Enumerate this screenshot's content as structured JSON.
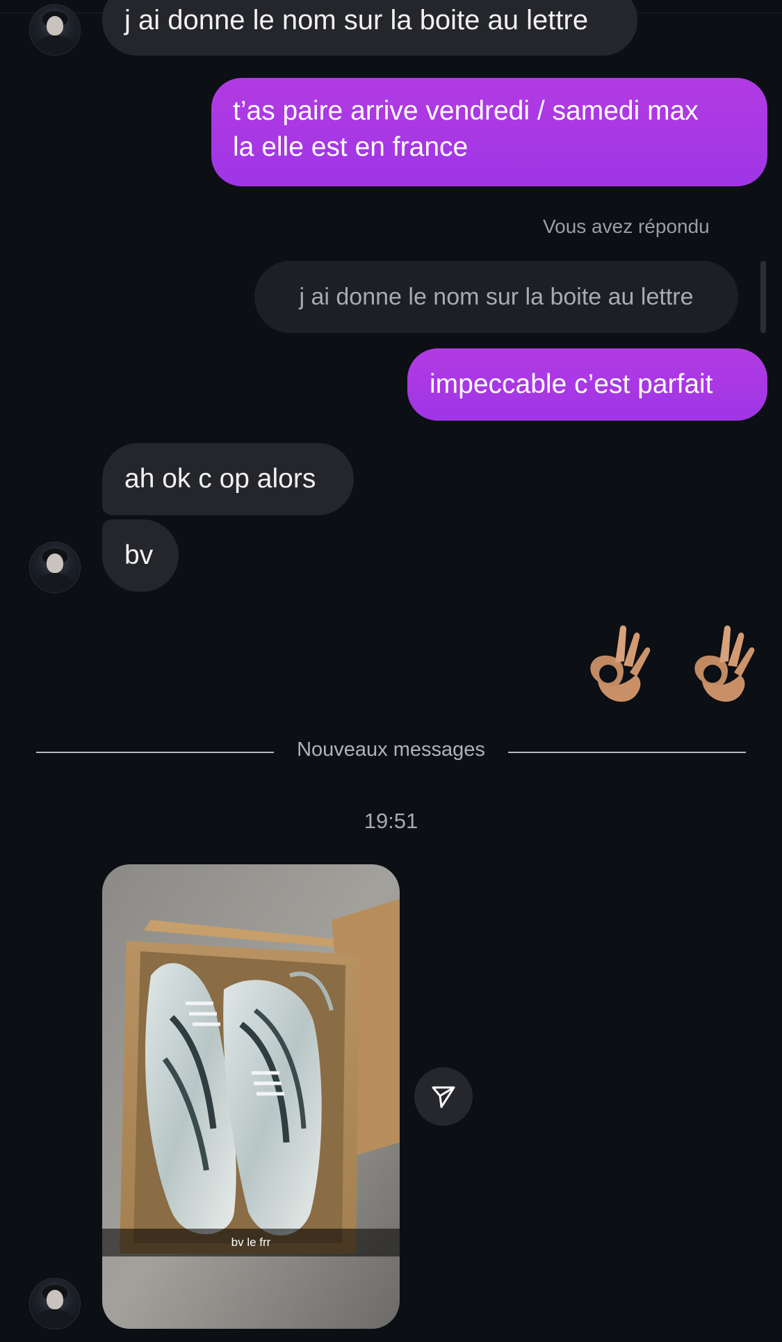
{
  "messages": {
    "partial_top": "j ai donne le nom sur la boite au lettre",
    "sent_1": "t’as paire arrive vendredi / samedi max\nla elle est en france",
    "reply_label": "Vous avez répondu",
    "reply_quote": "j ai donne le nom sur la boite au lettre",
    "sent_2": "impeccable c’est parfait",
    "received_1": "ah ok c op alors",
    "received_2": "bv",
    "reaction_emoji": "👌 👌"
  },
  "divider": {
    "label": "Nouveaux messages"
  },
  "timestamp": "19:51",
  "photo_message": {
    "caption": "bv le frr"
  },
  "colors": {
    "background": "#0c0f14",
    "incoming_bubble": "#24262b",
    "outgoing_bubble": "#a737e4"
  },
  "icons": {
    "share": "send-icon",
    "avatar": "avatar"
  }
}
